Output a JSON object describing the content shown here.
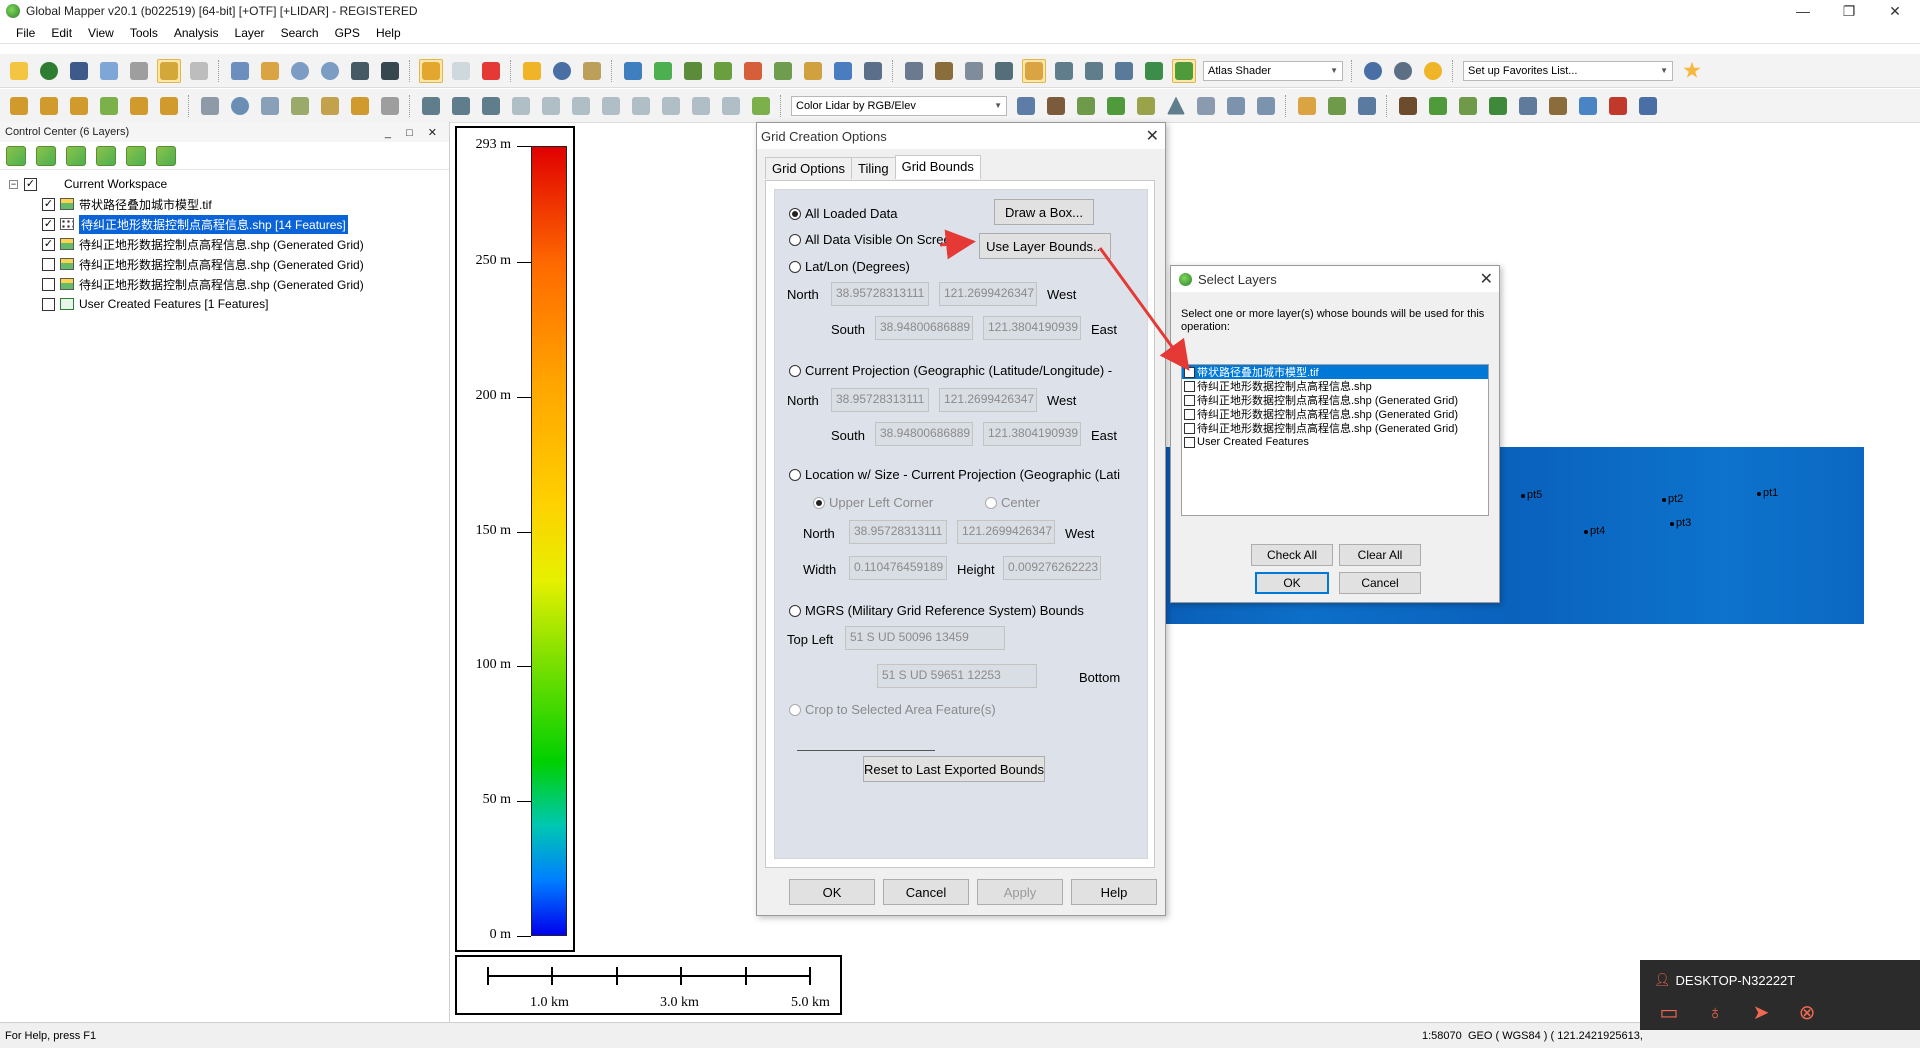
{
  "window": {
    "title": "Global Mapper v20.1 (b022519) [64-bit] [+OTF] [+LIDAR] - REGISTERED",
    "controls": [
      "—",
      "❐",
      "✕"
    ]
  },
  "menu": [
    "File",
    "Edit",
    "View",
    "Tools",
    "Analysis",
    "Layer",
    "Search",
    "GPS",
    "Help"
  ],
  "toolbar": {
    "shader_select": "Atlas Shader",
    "favorites_select": "Set up Favorites List...",
    "lidar_select": "Color Lidar by RGB/Elev"
  },
  "control_center": {
    "title": "Control Center (6 Layers)",
    "workspace": "Current Workspace",
    "layers": [
      {
        "label": "带状路径叠加城市模型.tif",
        "checked": true,
        "type": "raster",
        "selected": false
      },
      {
        "label": "待纠正地形数据控制点高程信息.shp [14 Features]",
        "checked": true,
        "type": "points",
        "selected": true
      },
      {
        "label": "待纠正地形数据控制点高程信息.shp (Generated Grid)",
        "checked": true,
        "type": "raster",
        "selected": false
      },
      {
        "label": "待纠正地形数据控制点高程信息.shp (Generated Grid)",
        "checked": false,
        "type": "raster",
        "selected": false
      },
      {
        "label": "待纠正地形数据控制点高程信息.shp (Generated Grid)",
        "checked": false,
        "type": "raster",
        "selected": false
      },
      {
        "label": "User Created Features [1 Features]",
        "checked": false,
        "type": "vector",
        "selected": false
      }
    ]
  },
  "elevation_legend": {
    "labels": [
      "293 m",
      "250 m",
      "200 m",
      "150 m",
      "100 m",
      "50 m",
      "0 m"
    ],
    "values_m": [
      293,
      250,
      200,
      150,
      100,
      50,
      0
    ]
  },
  "scale_bar": {
    "labels": [
      "1.0 km",
      "3.0 km",
      "5.0 km"
    ]
  },
  "map_points": [
    "pt5",
    "pt2",
    "pt1",
    "pt4",
    "pt3"
  ],
  "grid_dialog": {
    "title": "Grid Creation Options",
    "tabs": [
      "Grid Options",
      "Tiling",
      "Grid Bounds"
    ],
    "active_tab": "Grid Bounds",
    "opt_all_loaded": "All Loaded Data",
    "btn_draw_box": "Draw a Box...",
    "opt_all_visible": "All Data Visible On Screen",
    "btn_use_layer_bounds": "Use Layer Bounds...",
    "opt_latlon": "Lat/Lon (Degrees)",
    "north": "North",
    "south": "South",
    "west": "West",
    "east": "East",
    "latlon_north": "38.95728313111",
    "latlon_west": "121.2699426347",
    "latlon_south": "38.94800686889",
    "latlon_east": "121.3804190939",
    "opt_current_proj": "Current Projection (Geographic (Latitude/Longitude) -",
    "proj_north": "38.95728313111",
    "proj_west": "121.2699426347",
    "proj_south": "38.94800686889",
    "proj_east": "121.3804190939",
    "opt_location_size": "Location w/ Size - Current Projection (Geographic (Lati",
    "opt_upper_left": "Upper Left Corner",
    "opt_center": "Center",
    "ls_north": "38.95728313111",
    "ls_west": "121.2699426347",
    "width_label": "Width",
    "width_val": "0.110476459189",
    "height_label": "Height",
    "height_val": "0.009276262223",
    "opt_mgrs": "MGRS (Military Grid Reference System) Bounds",
    "top_left": "Top Left",
    "mgrs_top_left": "51 S UD 50096 13459",
    "mgrs_bottom_right": "51 S UD 59651 12253",
    "bottom": "Bottom",
    "opt_crop": "Crop to Selected Area Feature(s)",
    "btn_reset": "Reset to Last Exported Bounds",
    "btn_ok": "OK",
    "btn_cancel": "Cancel",
    "btn_apply": "Apply",
    "btn_help": "Help"
  },
  "select_layers": {
    "title": "Select Layers",
    "instructions": "Select one or more layer(s) whose bounds will be used for this operation:",
    "items": [
      {
        "label": "带状路径叠加城市模型.tif",
        "checked": true,
        "selected": true
      },
      {
        "label": "待纠正地形数据控制点高程信息.shp",
        "checked": false,
        "selected": false
      },
      {
        "label": "待纠正地形数据控制点高程信息.shp (Generated Grid)",
        "checked": false,
        "selected": false
      },
      {
        "label": "待纠正地形数据控制点高程信息.shp (Generated Grid)",
        "checked": false,
        "selected": false
      },
      {
        "label": "待纠正地形数据控制点高程信息.shp (Generated Grid)",
        "checked": false,
        "selected": false
      },
      {
        "label": "User Created Features",
        "checked": false,
        "selected": false
      }
    ],
    "btn_check_all": "Check All",
    "btn_clear_all": "Clear All",
    "btn_ok": "OK",
    "btn_cancel": "Cancel"
  },
  "status": {
    "help": "For Help, press F1",
    "scale": "1:58070",
    "coords": "GEO ( WGS84 ) ( 121.2421925613,"
  },
  "remote": {
    "machine": "DESKTOP-N32222T"
  },
  "colors": {
    "selection": "#0a64d8",
    "terrain": "#0a62bd",
    "arrow": "#e53935"
  }
}
